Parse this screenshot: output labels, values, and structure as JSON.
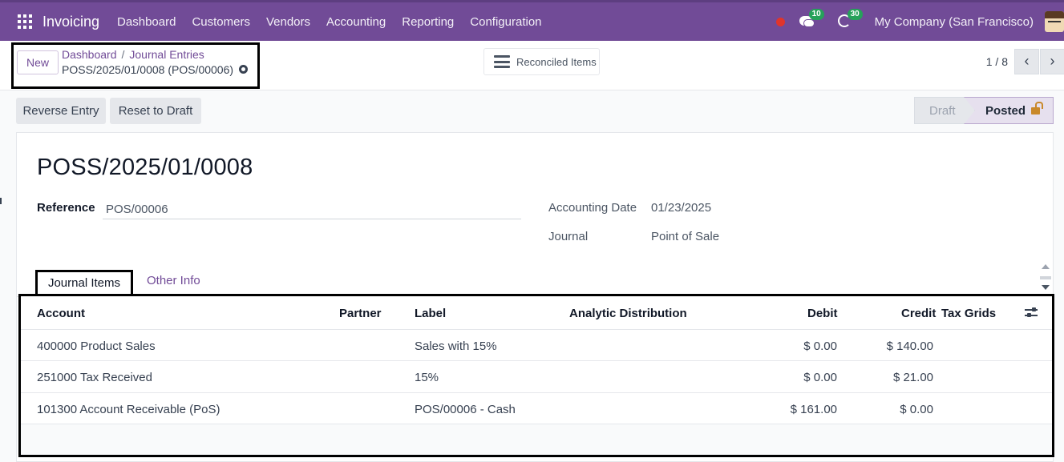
{
  "navbar": {
    "app_name": "Invoicing",
    "menu": [
      "Dashboard",
      "Customers",
      "Vendors",
      "Accounting",
      "Reporting",
      "Configuration"
    ],
    "messages_count": "10",
    "activities_count": "30",
    "company": "My Company (San Francisco)"
  },
  "control": {
    "new_label": "New",
    "breadcrumb": [
      "Dashboard",
      "Journal Entries"
    ],
    "record_name": "POSS/2025/01/0008 (POS/00006)",
    "reconciled_label": "Reconciled Items",
    "pager": "1 / 8",
    "prev": "‹",
    "next": "›"
  },
  "actions": {
    "reverse": "Reverse Entry",
    "reset": "Reset to Draft"
  },
  "status": {
    "draft": "Draft",
    "posted": "Posted",
    "current": "Posted"
  },
  "form": {
    "title": "POSS/2025/01/0008",
    "reference_label": "Reference",
    "reference_value": "POS/00006",
    "accounting_date_label": "Accounting Date",
    "accounting_date_value": "01/23/2025",
    "journal_label": "Journal",
    "journal_value": "Point of Sale"
  },
  "tabs": {
    "journal_items": "Journal Items",
    "other_info": "Other Info"
  },
  "table": {
    "headers": {
      "account": "Account",
      "partner": "Partner",
      "label": "Label",
      "analytic": "Analytic Distribution",
      "debit": "Debit",
      "credit": "Credit",
      "tax_grids": "Tax Grids"
    },
    "rows": [
      {
        "account": "400000 Product Sales",
        "partner": "",
        "label": "Sales  with 15%",
        "debit": "$ 0.00",
        "credit": "$ 140.00"
      },
      {
        "account": "251000 Tax Received",
        "partner": "",
        "label": "15%",
        "debit": "$ 0.00",
        "credit": "$ 21.00"
      },
      {
        "account": "101300 Account Receivable (PoS)",
        "partner": "",
        "label": "POS/00006 - Cash",
        "debit": "$ 161.00",
        "credit": "$ 0.00"
      }
    ]
  },
  "colors": {
    "brand": "#714b97",
    "badge": "#26a15a",
    "record_dot": "#e0352b"
  }
}
